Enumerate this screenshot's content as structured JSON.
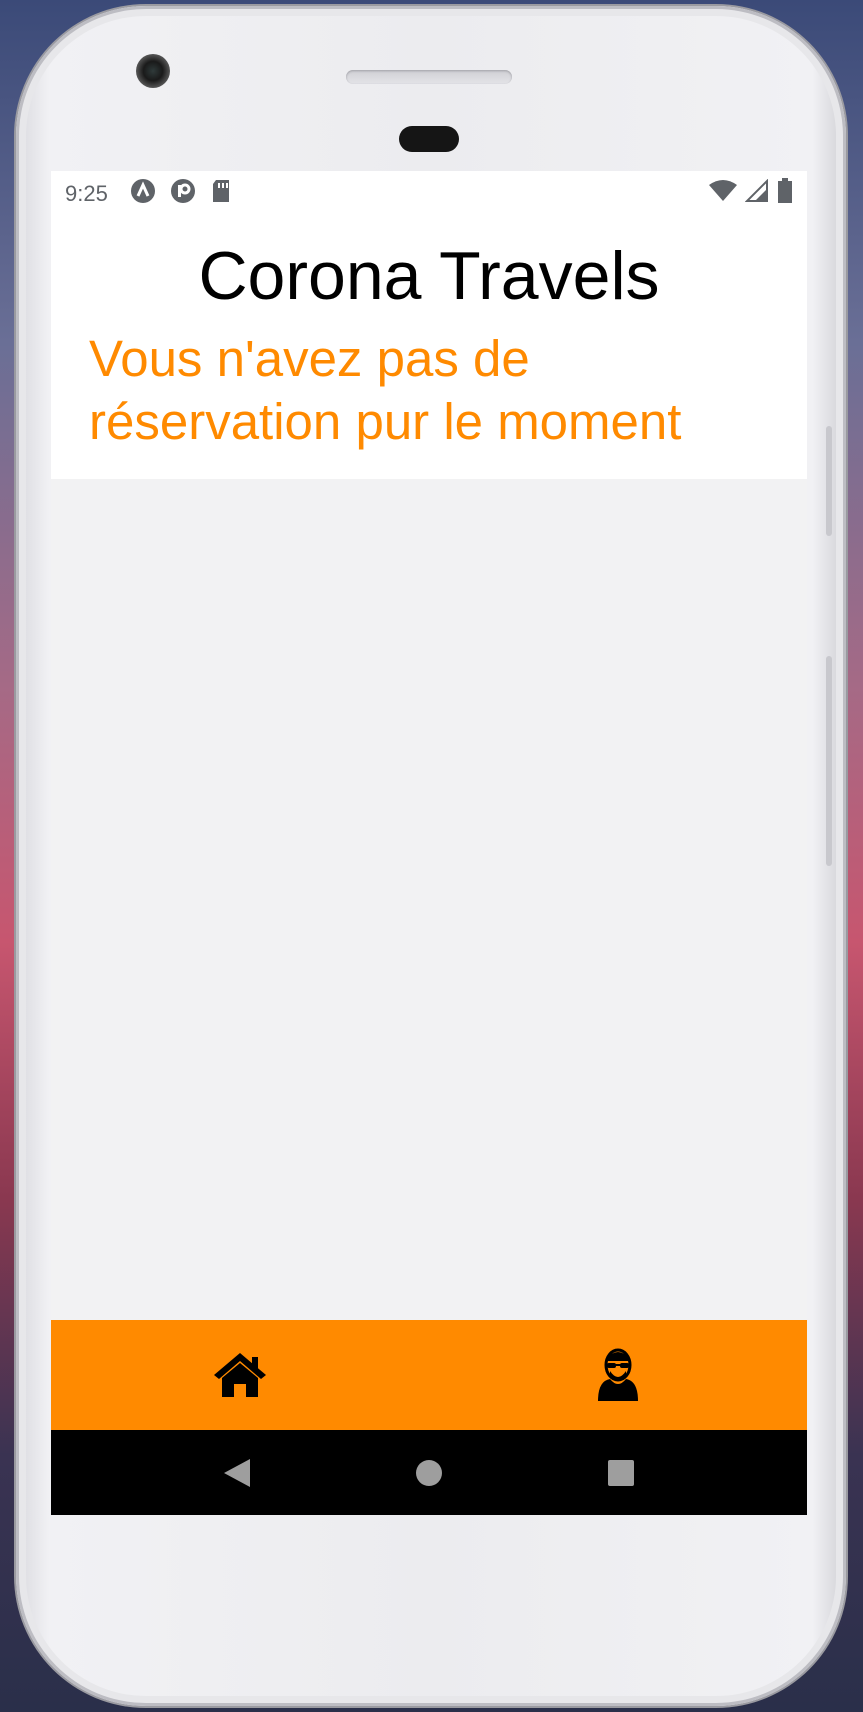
{
  "status_bar": {
    "time": "9:25",
    "left_icons": [
      "a-letter-icon",
      "p-letter-icon",
      "sd-card-icon"
    ],
    "right_icons": [
      "wifi-icon",
      "cell-signal-icon",
      "battery-icon"
    ]
  },
  "app": {
    "title": "Corona Travels",
    "empty_message": "Vous n'avez pas de réservation pur le moment"
  },
  "tab_bar": {
    "tabs": [
      {
        "icon": "home-icon"
      },
      {
        "icon": "user-avatar-icon"
      }
    ]
  },
  "nav_bar": {
    "buttons": [
      "back-icon",
      "home-circle-icon",
      "recents-square-icon"
    ]
  },
  "colors": {
    "accent": "#ff8a00",
    "screen_background": "#f2f2f3",
    "header_background": "#ffffff",
    "nav_background": "#000000"
  }
}
